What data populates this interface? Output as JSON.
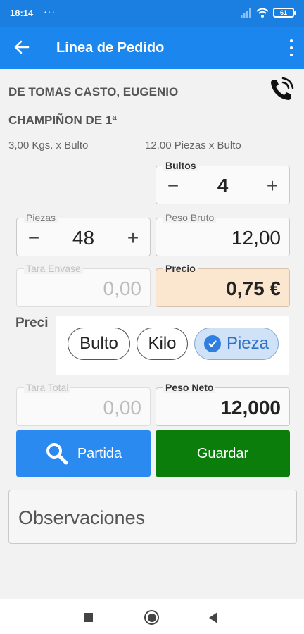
{
  "status_bar": {
    "time": "18:14",
    "dots": "···",
    "battery": "61"
  },
  "app_bar": {
    "title": "Linea de Pedido",
    "back_icon": "arrow-back-icon",
    "menu_icon": "more-vert-icon"
  },
  "order": {
    "client": "DE TOMAS CASTO, EUGENIO",
    "product": "CHAMPIÑON DE 1ª",
    "unit_kgs": "3,00 Kgs. x Bulto",
    "unit_piezas": "12,00 Piezas x Bulto"
  },
  "fields": {
    "bultos": {
      "label": "Bultos",
      "value": "4",
      "minus": "−",
      "plus": "+"
    },
    "piezas": {
      "label": "Piezas",
      "value": "48",
      "minus": "−",
      "plus": "+"
    },
    "peso_bruto": {
      "label": "Peso Bruto",
      "value": "12,00"
    },
    "tara_envase": {
      "label": "Tara Envase",
      "value": "0,00"
    },
    "precio": {
      "label": "Precio",
      "value": "0,75 €"
    },
    "tara_total": {
      "label": "Tara Total",
      "value": "0,00"
    },
    "peso_neto": {
      "label": "Peso Neto",
      "value": "12,000"
    }
  },
  "price_mode": {
    "label": "Preci",
    "options": [
      "Bulto",
      "Kilo",
      "Pieza"
    ],
    "selected": "Pieza"
  },
  "buttons": {
    "partida": "Partida",
    "guardar": "Guardar"
  },
  "observaciones": {
    "placeholder": "Observaciones"
  },
  "colors": {
    "app_bar": "#1a86ee",
    "status_bar": "#1a7fe0",
    "partida_button": "#2b8af0",
    "guardar_button": "#0b7d0b",
    "price_field": "#fbe6cf",
    "selected_pill": "#cfe2f8"
  }
}
